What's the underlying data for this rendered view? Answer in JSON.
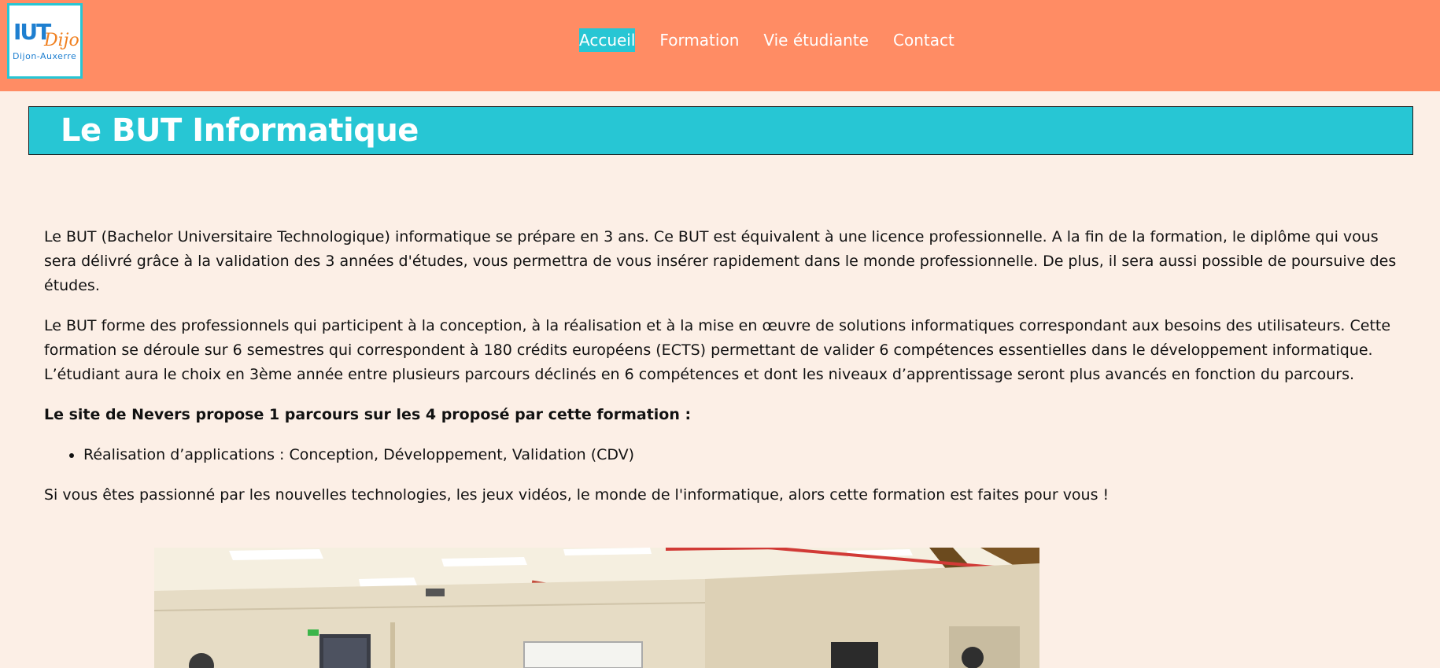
{
  "header": {
    "logo": {
      "iut": "IUT",
      "city": "Dijon",
      "subtitle": "Dijon-Auxerre"
    },
    "nav": [
      {
        "label": "Accueil",
        "active": true
      },
      {
        "label": "Formation",
        "active": false
      },
      {
        "label": "Vie étudiante",
        "active": false
      },
      {
        "label": "Contact",
        "active": false
      }
    ]
  },
  "page": {
    "title": "Le BUT Informatique"
  },
  "content": {
    "paragraph_1": "Le BUT (Bachelor Universitaire Technologique) informatique se prépare en 3 ans. Ce BUT est équivalent à une licence professionnelle. A la fin de la formation, le diplôme qui vous sera délivré grâce à la validation des 3 années d'études, vous permettra de vous insérer rapidement dans le monde professionnelle. De plus, il sera aussi possible de poursuive des études.",
    "paragraph_2": "Le BUT forme des professionnels qui participent à la conception, à la réalisation et à la mise en œuvre de solutions informatiques correspondant aux besoins des utilisateurs. Cette formation se déroule sur 6 semestres qui correspondent à 180 crédits européens (ECTS) permettant de valider 6 compétences essentielles dans le développement informatique. L’étudiant aura le choix en 3ème année entre plusieurs parcours déclinés en 6 compétences et dont les niveaux d’apprentissage seront plus avancés en fonction du parcours.",
    "parcours_heading": "Le site de Nevers propose 1 parcours sur les 4 proposé par cette formation :",
    "parcours": [
      "Réalisation d’applications : Conception, Développement, Validation (CDV)"
    ],
    "paragraph_3": "Si vous êtes passionné par les nouvelles technologies, les jeux vidéos, le monde de l'informatique, alors cette formation est faites pour vous !"
  },
  "colors": {
    "header_bg": "#ff8c64",
    "accent": "#27c6d4",
    "page_bg": "#fcefe6"
  }
}
